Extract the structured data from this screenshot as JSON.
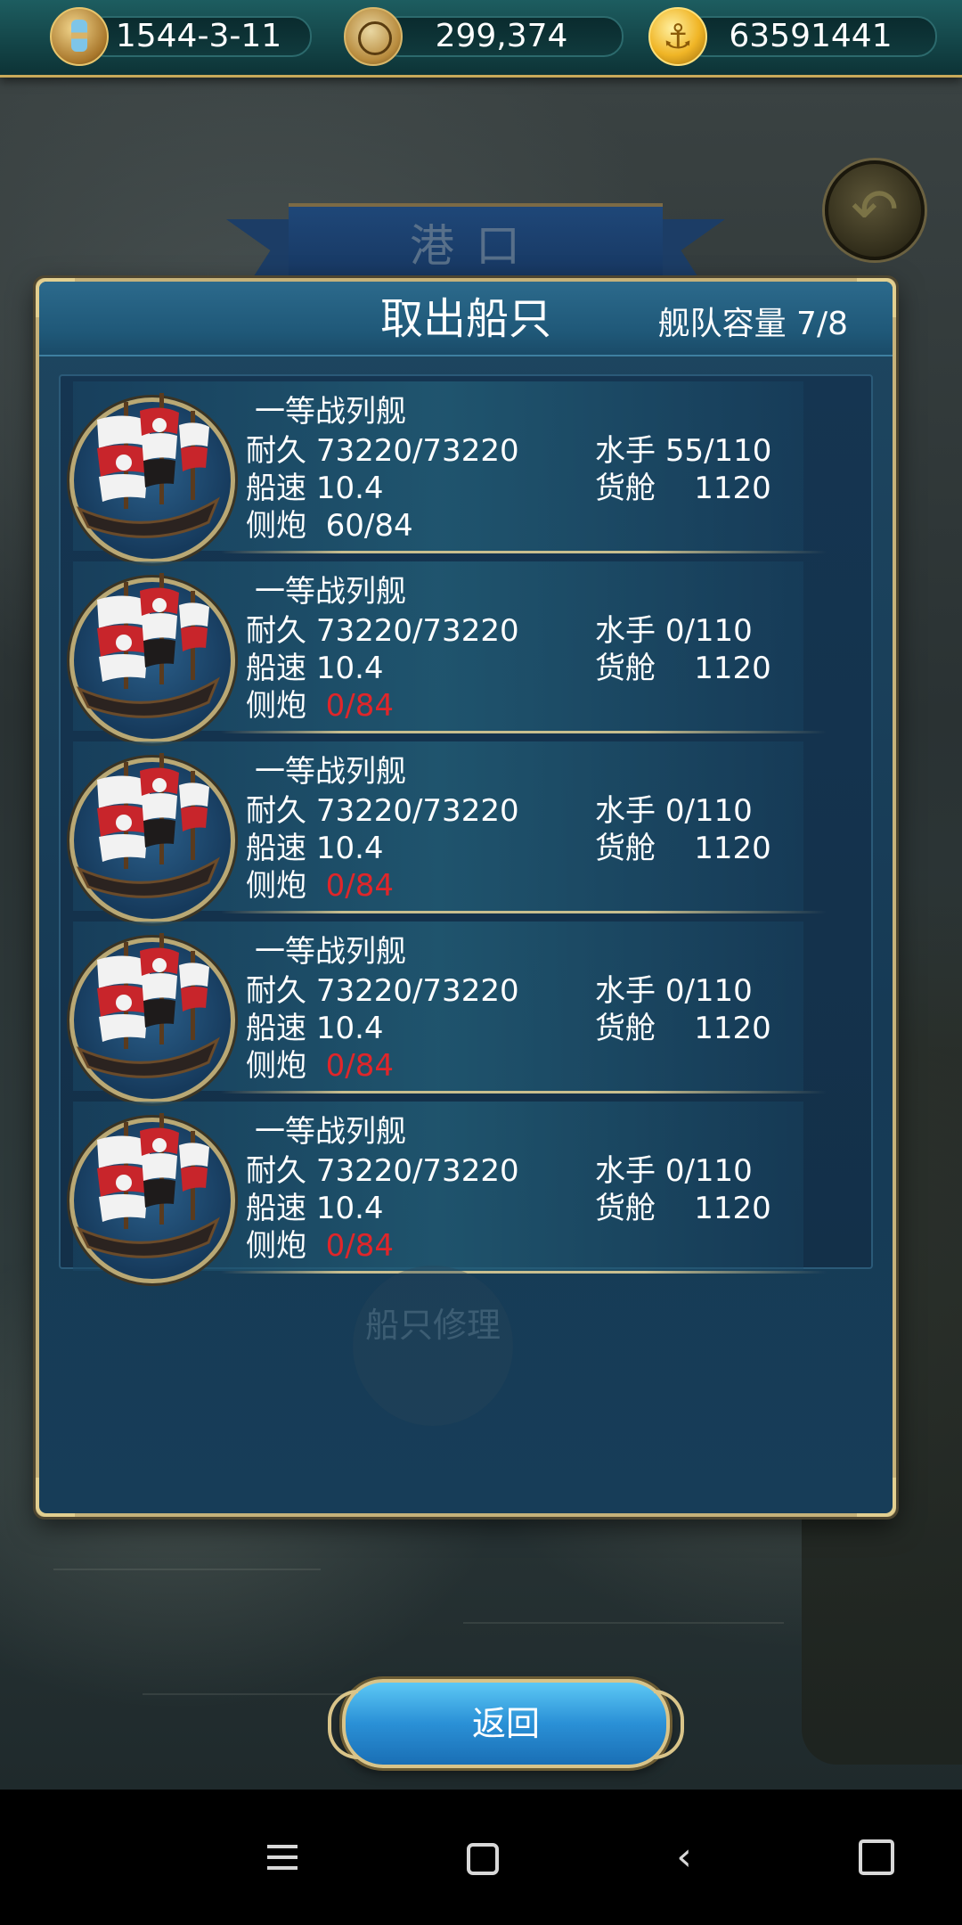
{
  "topbar": {
    "date": "1544-3-11",
    "reputation": "299,374",
    "gold": "63591441",
    "icons": [
      "hourglass-icon",
      "compass-icon",
      "gold-coin-anchor-icon"
    ]
  },
  "port": {
    "title": "港口"
  },
  "ghost_button": {
    "label": "船只修理"
  },
  "dialog": {
    "title": "取出船只",
    "capacity": "舰队容量 7/8",
    "ships": [
      {
        "name": "一等战列舰",
        "durability_label": "耐久",
        "durability": "73220/73220",
        "sailors_label": "水手",
        "sailors": "55/110",
        "speed_label": "船速",
        "speed": "10.4",
        "cargo_label": "货舱",
        "cargo": "1120",
        "cannon_label": "侧炮",
        "cannon": "60/84",
        "cannon_empty": false
      },
      {
        "name": "一等战列舰",
        "durability_label": "耐久",
        "durability": "73220/73220",
        "sailors_label": "水手",
        "sailors": "0/110",
        "speed_label": "船速",
        "speed": "10.4",
        "cargo_label": "货舱",
        "cargo": "1120",
        "cannon_label": "侧炮",
        "cannon": "0/84",
        "cannon_empty": true
      },
      {
        "name": "一等战列舰",
        "durability_label": "耐久",
        "durability": "73220/73220",
        "sailors_label": "水手",
        "sailors": "0/110",
        "speed_label": "船速",
        "speed": "10.4",
        "cargo_label": "货舱",
        "cargo": "1120",
        "cannon_label": "侧炮",
        "cannon": "0/84",
        "cannon_empty": true
      },
      {
        "name": "一等战列舰",
        "durability_label": "耐久",
        "durability": "73220/73220",
        "sailors_label": "水手",
        "sailors": "0/110",
        "speed_label": "船速",
        "speed": "10.4",
        "cargo_label": "货舱",
        "cargo": "1120",
        "cannon_label": "侧炮",
        "cannon": "0/84",
        "cannon_empty": true
      },
      {
        "name": "一等战列舰",
        "durability_label": "耐久",
        "durability": "73220/73220",
        "sailors_label": "水手",
        "sailors": "0/110",
        "speed_label": "船速",
        "speed": "10.4",
        "cargo_label": "货舱",
        "cargo": "1120",
        "cannon_label": "侧炮",
        "cannon": "0/84",
        "cannon_empty": true
      }
    ],
    "return_label": "返回"
  },
  "colors": {
    "cannon_empty": "#e0262a",
    "frame_gold": "#c6b27a",
    "dialog_blue": "#1e4660",
    "button_blue": "#2a90d6"
  }
}
